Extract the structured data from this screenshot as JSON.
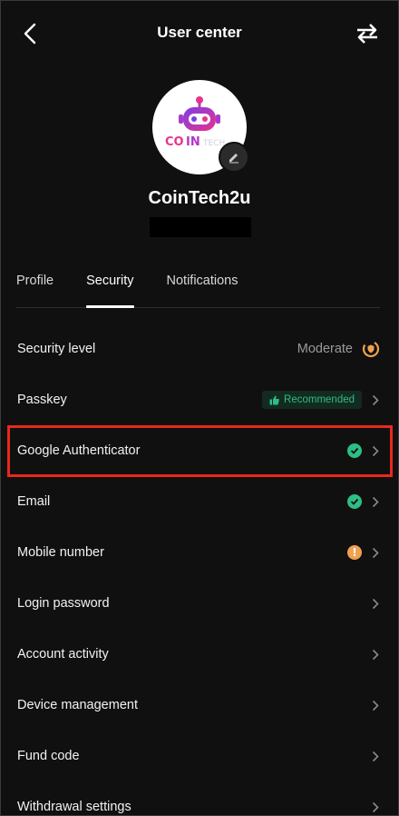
{
  "header": {
    "title": "User center",
    "back_icon": "chevron-left-icon",
    "switch_icon": "swap-arrows-icon"
  },
  "profile": {
    "username": "CoinTech2u",
    "avatar_logo_text": "COINTECH",
    "edit_icon": "pencil-icon"
  },
  "tabs": [
    {
      "label": "Profile",
      "active": false
    },
    {
      "label": "Security",
      "active": true
    },
    {
      "label": "Notifications",
      "active": false
    }
  ],
  "rows": {
    "security_level": {
      "label": "Security level",
      "value": "Moderate",
      "icon": "shield-gauge-icon"
    },
    "passkey": {
      "label": "Passkey",
      "badge": "Recommended",
      "badge_icon": "thumbs-up-icon"
    },
    "google_auth": {
      "label": "Google Authenticator",
      "status": "check-circle-icon"
    },
    "email": {
      "label": "Email",
      "status": "check-circle-icon"
    },
    "mobile": {
      "label": "Mobile number",
      "status": "warning-circle-icon"
    },
    "login_password": {
      "label": "Login password"
    },
    "account_activity": {
      "label": "Account activity"
    },
    "device_management": {
      "label": "Device management"
    },
    "fund_code": {
      "label": "Fund code"
    },
    "withdrawal_settings": {
      "label": "Withdrawal settings"
    }
  },
  "colors": {
    "success": "#2ebd85",
    "warning": "#f0a050",
    "highlight": "#e8291c",
    "background": "#101010"
  }
}
